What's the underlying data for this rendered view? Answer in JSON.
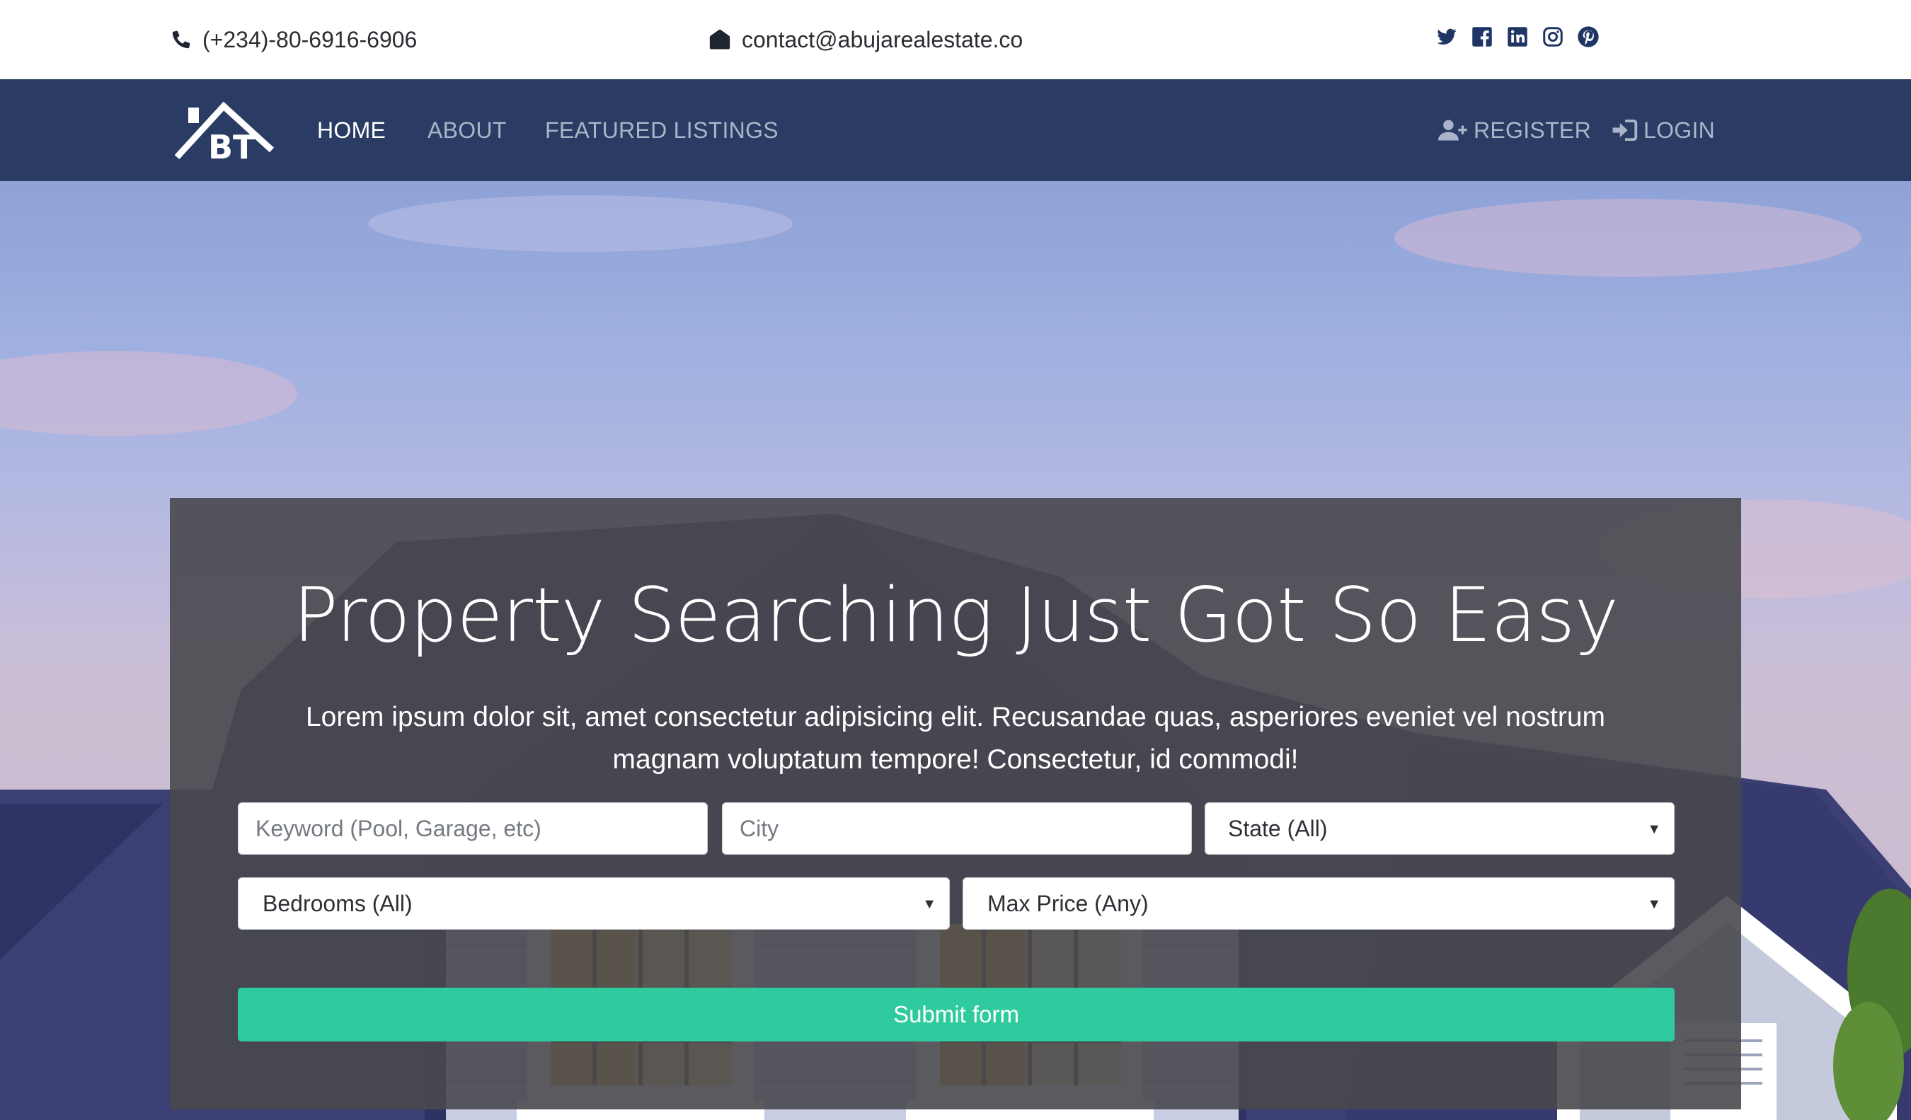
{
  "topbar": {
    "phone": "(+234)-80-6916-6906",
    "email": "contact@abujarealestate.co",
    "social": [
      "twitter-icon",
      "facebook-icon",
      "linkedin-icon",
      "instagram-icon",
      "pinterest-icon"
    ]
  },
  "navbar": {
    "logo_text": "BT",
    "links": [
      "HOME",
      "ABOUT",
      "FEATURED LISTINGS"
    ],
    "register": "REGISTER",
    "login": "LOGIN"
  },
  "hero": {
    "title": "Property Searching Just Got So Easy",
    "subtitle": "Lorem ipsum dolor sit, amet consectetur adipisicing elit. Recusandae quas, asperiores eveniet vel nostrum magnam voluptatum tempore! Consectetur, id commodi!"
  },
  "search": {
    "keyword_placeholder": "Keyword (Pool, Garage, etc)",
    "city_placeholder": "City",
    "state_value": "State (All)",
    "bedrooms_value": "Bedrooms (All)",
    "maxprice_value": "Max Price (Any)",
    "submit_label": "Submit form"
  },
  "colors": {
    "navbar": "#2a3c63",
    "accent": "#2fcb9f",
    "panel": "#48484e"
  }
}
